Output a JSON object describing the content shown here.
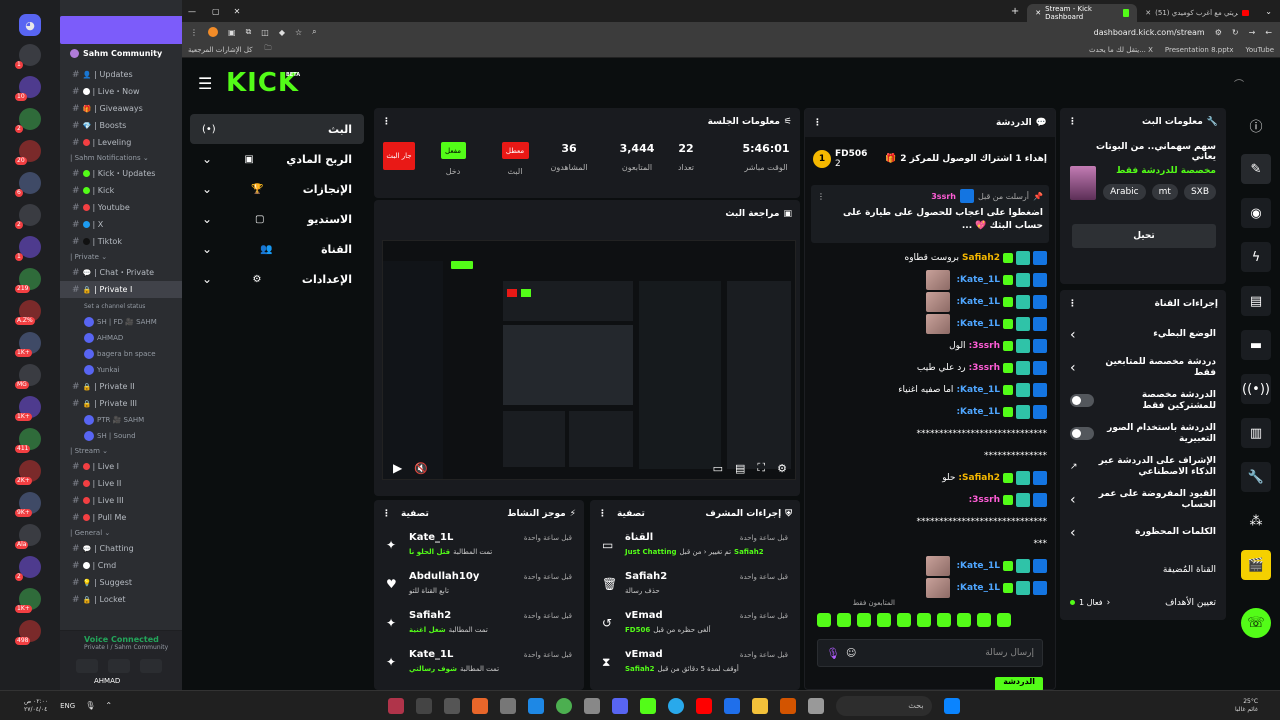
{
  "browser": {
    "tabs": [
      {
        "label": "Stream - Kick Dashboard"
      },
      {
        "label": "(51) تحريتي مع أغرب كوميدي..."
      }
    ],
    "url": "dashboard.kick.com/stream",
    "bookmarks": {
      "all_bookmarks": "كل الإشارات المرجعية",
      "items": [
        "يتقل لك ما يحدث... X",
        "Presentation 8.pptx",
        "YouTube"
      ]
    }
  },
  "discord": {
    "server_name": "Sahm Community",
    "server_badges": [
      "1",
      "10",
      "2",
      "20",
      "6",
      "2",
      "1",
      "219",
      "A.Z%",
      "1K+",
      "MG",
      "1K+",
      "411",
      "2K+",
      "9K+",
      "Ala",
      "2",
      "1K+",
      "498"
    ],
    "channels": [
      {
        "type": "ch",
        "label": "| Updates",
        "icon": "👤"
      },
      {
        "type": "ch",
        "label": "| Live・Now",
        "dot": "#ffffff"
      },
      {
        "type": "ch",
        "label": "| Giveaways",
        "icon": "🎁"
      },
      {
        "type": "ch",
        "label": "| Boosts",
        "icon": "💎"
      },
      {
        "type": "ch",
        "label": "| Leveling",
        "dot": "#f23f42"
      },
      {
        "type": "group",
        "label": "| Sahm Notifications ⌄"
      },
      {
        "type": "ch",
        "label": "| Kick・Updates",
        "dot": "#53fc18"
      },
      {
        "type": "ch",
        "label": "| Kick",
        "dot": "#53fc18"
      },
      {
        "type": "ch",
        "label": "| Youtube",
        "dot": "#f23f42"
      },
      {
        "type": "ch",
        "label": "| X",
        "dot": "#1d9bf0"
      },
      {
        "type": "ch",
        "label": "| Tiktok",
        "dot": "#111111"
      },
      {
        "type": "group",
        "label": "| Private ⌄"
      },
      {
        "type": "ch",
        "label": "| Chat・Private",
        "icon": "💬"
      },
      {
        "type": "ch",
        "label": "| Private I",
        "active": true
      },
      {
        "type": "sub",
        "label": "Set a channel status"
      },
      {
        "type": "vc",
        "label": "SH | FD 🎥 SAHM"
      },
      {
        "type": "vc",
        "label": "AHMAD"
      },
      {
        "type": "vc",
        "label": "bagera bn space"
      },
      {
        "type": "vc",
        "label": "Yunkai"
      },
      {
        "type": "ch",
        "label": "| Private II"
      },
      {
        "type": "ch",
        "label": "| Private III"
      },
      {
        "type": "vc",
        "label": "PTR 🎥 SAHM"
      },
      {
        "type": "vc",
        "label": "SH | Sound"
      },
      {
        "type": "group",
        "label": "| Stream ⌄"
      },
      {
        "type": "ch",
        "label": "| Live I",
        "dot": "#f23f42"
      },
      {
        "type": "ch",
        "label": "| Live II",
        "dot": "#f23f42"
      },
      {
        "type": "ch",
        "label": "| Live III",
        "dot": "#f23f42"
      },
      {
        "type": "ch",
        "label": "| Pull Me",
        "dot": "#f23f42"
      },
      {
        "type": "group",
        "label": "| General ⌄"
      },
      {
        "type": "ch",
        "label": "| Chatting",
        "icon": "💬"
      },
      {
        "type": "ch",
        "label": "| Cmd",
        "dot": "#ffffff"
      },
      {
        "type": "ch",
        "label": "| Suggest",
        "icon": "💡"
      },
      {
        "type": "ch",
        "label": "| Locket",
        "icon": "🔒"
      }
    ],
    "voice_status": "Voice Connected",
    "voice_sub": "Private I / Sahm Community",
    "user": "AHMAD"
  },
  "kick": {
    "logo": "KICK",
    "beta": "BETA",
    "nav": [
      {
        "label": "البث",
        "icon": "(•)",
        "active": true
      },
      {
        "label": "الربح المادي",
        "icon": "▣"
      },
      {
        "label": "الإنجازات",
        "icon": "🏆"
      },
      {
        "label": "الاستديو",
        "icon": "▢"
      },
      {
        "label": "القناة",
        "icon": "👥"
      },
      {
        "label": "الإعدادات",
        "icon": "⚙"
      }
    ],
    "session": {
      "title": "معلومات الجلسة",
      "buttons": [
        {
          "label": "جار البث",
          "color": "red"
        },
        {
          "label": "مفعل",
          "sub": "دخل",
          "color": "green"
        },
        {
          "label": "معطل",
          "sub": "البث",
          "color": "red"
        }
      ],
      "stats": [
        {
          "value": "36",
          "label": "المشاهدون"
        },
        {
          "value": "3,444",
          "label": "المتابعون"
        },
        {
          "value": "22",
          "label": "تعداد"
        },
        {
          "value": "5:46:01",
          "label": "الوقت مباشر"
        }
      ]
    },
    "preview": {
      "title": "مراجعة البث"
    },
    "activity": {
      "title": "موجز النشاط",
      "filter": "تصفية",
      "items": [
        {
          "user": "Kate_1L",
          "desc": "تمت المطالبة",
          "highlight": "قتل الحلو نا",
          "time": "قبل ساعة واحدة",
          "icon": "✦"
        },
        {
          "user": "Abdullah10y",
          "desc": "تابع القناة للتو",
          "time": "قبل ساعة واحدة",
          "icon": "♥"
        },
        {
          "user": "Safiah2",
          "desc": "تمت المطالبة",
          "highlight": "شغل اغنية",
          "time": "قبل ساعة واحدة",
          "icon": "✦"
        },
        {
          "user": "Kate_1L",
          "desc": "تمت المطالبة",
          "highlight": "شوف رسالتي",
          "time": "قبل ساعة واحدة",
          "icon": "✦"
        }
      ]
    },
    "mod": {
      "title": "إجراءات المشرف",
      "filter": "تصفية",
      "items": [
        {
          "user": "القناة",
          "desc_before": "Safiah2",
          "desc": "تم تغيير ‹ من قبل",
          "highlight": "Just Chatting",
          "time": "قبل ساعة واحدة",
          "icon": "▭"
        },
        {
          "user": "Safiah2",
          "desc": "حذف رسالة",
          "time": "قبل ساعة واحدة",
          "icon": "🗑"
        },
        {
          "user": "vEmad",
          "desc": "ألغى حظره من قبل",
          "highlight": "FD506",
          "time": "قبل ساعة واحدة",
          "icon": "↺"
        },
        {
          "user": "vEmad",
          "desc": "أوقف لمدة 5 دقائق من قبل",
          "highlight": "Safiah2",
          "time": "قبل ساعة واحدة",
          "icon": "⧗"
        }
      ]
    },
    "chat": {
      "title": "الدردشة",
      "top_user": "FD506",
      "top_rank": "1",
      "top_count": "2",
      "top_text": "إهداء 1 اشتراك الوصول للمركز 2",
      "pinned_by": "أرسلت من قبل",
      "pinned_user": "3ssrh",
      "pinned_msg": "اضغطوا على اعجاب للحصول على طيارة على حساب البثك 💖 ...",
      "messages": [
        {
          "user": "Safiah2",
          "color": "#f5b800",
          "text": "بروست قطاوه",
          "thumb": false
        },
        {
          "user": "Kate_1L:",
          "color": "#4fa6ff",
          "text": "",
          "thumb": true
        },
        {
          "user": "Kate_1L:",
          "color": "#4fa6ff",
          "text": "",
          "thumb": true
        },
        {
          "user": "Kate_1L:",
          "color": "#4fa6ff",
          "text": "",
          "thumb": true
        },
        {
          "user": "3ssrh:",
          "color": "#ff5dd7",
          "text": "الول",
          "thumb": false
        },
        {
          "user": "3ssrh:",
          "color": "#ff5dd7",
          "text": "رد علي طيب",
          "thumb": false
        },
        {
          "user": "Kate_1L:",
          "color": "#4fa6ff",
          "text": "اما صفيه اغنياء",
          "thumb": false
        },
        {
          "user": "Kate_1L:",
          "color": "#4fa6ff",
          "text": "",
          "thumb": false
        },
        {
          "user": "",
          "color": "#fff",
          "text": "*****************************",
          "thumb": false
        },
        {
          "user": "",
          "color": "#fff",
          "text": "**************",
          "thumb": false
        },
        {
          "user": "Safiah2:",
          "color": "#f5b800",
          "text": "حلو",
          "thumb": false
        },
        {
          "user": "3ssrh:",
          "color": "#ff5dd7",
          "text": "",
          "thumb": false
        },
        {
          "user": "",
          "color": "#fff",
          "text": "*****************************",
          "thumb": false
        },
        {
          "user": "",
          "color": "#fff",
          "text": "***",
          "thumb": false
        },
        {
          "user": "Kate_1L:",
          "color": "#4fa6ff",
          "text": "",
          "thumb": true
        },
        {
          "user": "Kate_1L:",
          "color": "#4fa6ff",
          "text": "",
          "thumb": true
        }
      ],
      "followers_only": "المتابعون فقط",
      "input_placeholder": "إرسال رسالة",
      "send_label": "الدردشة"
    },
    "stream_info": {
      "title": "معلومات البث",
      "stream_title": "سهم سهماني.. من البوتات يعاني",
      "category": "مخصصة للدردشة فقط",
      "tags": [
        "Arabic",
        "mt",
        "SXB"
      ],
      "edit_label": "تحيل"
    },
    "channel_actions": {
      "title": "إجراءات القناة",
      "rows": [
        {
          "label": "الوضع البطيء",
          "control": "chevron"
        },
        {
          "label": "دردشة مخصصة للمتابعين فقط",
          "control": "chevron"
        },
        {
          "label": "الدردشة مخصصة للمشتركين فقط",
          "control": "toggle"
        },
        {
          "label": "الدردشة باستخدام الصور التعبيرية",
          "control": "toggle"
        },
        {
          "label": "الإشراف على الدردشة عبر الذكاء الاصطناعي",
          "control": "ext"
        },
        {
          "label": "القيود المفروضة على عمر الحساب",
          "control": "chevron"
        },
        {
          "label": "الكلمات المحظورة",
          "control": "chevron"
        }
      ],
      "hidden_label": "القناة المُضيفة",
      "goals_label": "تعيين الأهداف",
      "goals_status": "فعال 1"
    }
  },
  "taskbar": {
    "time": "٠٢:٠٠ ص",
    "date": "٢٧/٠٤/٠٤",
    "lang": "ENG",
    "weather": "25°C",
    "weather_sub": "غائم غالبا",
    "search": "بحث"
  }
}
